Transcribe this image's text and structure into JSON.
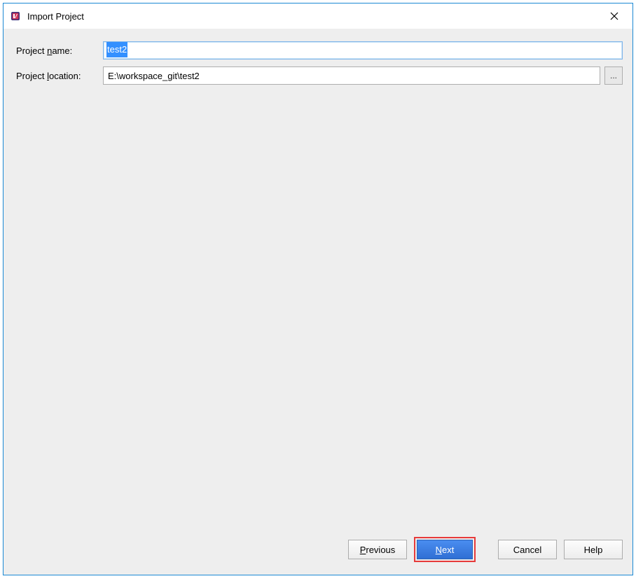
{
  "title": "Import Project",
  "form": {
    "project_name_label_pre": "Project ",
    "project_name_label_mnemonic": "n",
    "project_name_label_post": "ame:",
    "project_name_value": "test2",
    "project_location_label_pre": "Project ",
    "project_location_label_mnemonic": "l",
    "project_location_label_post": "ocation:",
    "project_location_value": "E:\\workspace_git\\test2",
    "browse_label": "..."
  },
  "buttons": {
    "previous_mnemonic": "P",
    "previous_post": "revious",
    "next_mnemonic": "N",
    "next_post": "ext",
    "cancel": "Cancel",
    "help": "Help"
  }
}
